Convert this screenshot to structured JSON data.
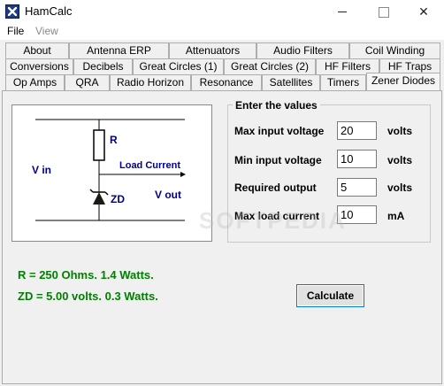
{
  "window": {
    "title": "HamCalc"
  },
  "menu": [
    {
      "label": "File",
      "enabled": true
    },
    {
      "label": "View",
      "enabled": false
    }
  ],
  "tabs": {
    "row1": [
      "About",
      "Antenna ERP",
      "Attenuators",
      "Audio Filters",
      "Coil Winding"
    ],
    "row2": [
      "Conversions",
      "Decibels",
      "Great Circles (1)",
      "Great Circles (2)",
      "HF Filters",
      "HF Traps"
    ],
    "row3": [
      "Op Amps",
      "QRA",
      "Radio Horizon",
      "Resonance",
      "Satellites",
      "Timers",
      "Zener Diodes"
    ],
    "active": "Zener Diodes"
  },
  "diagram": {
    "vin_label": "V in",
    "resistor_label": "R",
    "load_current_label": "Load Current",
    "zener_label": "ZD",
    "vout_label": "V out",
    "label_color": "#00008b",
    "line_color": "#000000"
  },
  "values_group": {
    "title": "Enter the values",
    "fields": [
      {
        "label": "Max input voltage",
        "value": "20",
        "unit": "volts"
      },
      {
        "label": "Min input voltage",
        "value": "10",
        "unit": "volts"
      },
      {
        "label": "Required output",
        "value": "5",
        "unit": "volts"
      },
      {
        "label": "Max load current",
        "value": "10",
        "unit": "mA"
      }
    ]
  },
  "results": {
    "line1": "R = 250 Ohms.   1.4 Watts.",
    "line2": "ZD = 5.00 volts.  0.3 Watts.",
    "color": "#008000"
  },
  "calculate_button": "Calculate",
  "watermark": "SOFTPEDIA",
  "icons": {
    "app": "app-icon",
    "minimize": "minimize-icon",
    "maximize": "maximize-icon",
    "close": "close-icon"
  }
}
